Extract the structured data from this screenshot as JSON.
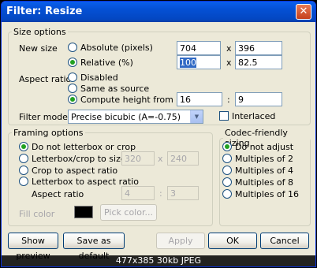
{
  "window": {
    "title": "Filter: Resize"
  },
  "size_options": {
    "legend": "Size options",
    "new_size_label": "New size",
    "absolute_label": "Absolute (pixels)",
    "absolute_w": "704",
    "absolute_h": "396",
    "relative_label": "Relative (%)",
    "relative_w": "100",
    "relative_h": "82.5",
    "times": "x",
    "aspect_ratio_label": "Aspect ratio",
    "disabled_label": "Disabled",
    "same_label": "Same as source",
    "compute_label": "Compute height from ratio:",
    "ratio_a": "16",
    "ratio_b": "9",
    "colon": ":",
    "filter_mode_label": "Filter mode",
    "filter_mode_value": "Precise bicubic (A=-0.75)",
    "interlaced_label": "Interlaced"
  },
  "framing": {
    "legend": "Framing options",
    "no_letterbox": "Do not letterbox or crop",
    "letterbox_size": "Letterbox/crop to size:",
    "size_w": "320",
    "size_h": "240",
    "times": "x",
    "crop_aspect": "Crop to aspect ratio",
    "letterbox_aspect": "Letterbox to aspect ratio",
    "aspect_ratio_label": "Aspect ratio",
    "ar_a": "4",
    "ar_b": "3",
    "colon": ":",
    "fill_color_label": "Fill color",
    "fill_color": "#000000",
    "pick_color": "Pick color..."
  },
  "codec": {
    "legend": "Codec-friendly sizing",
    "options": [
      "Do not adjust",
      "Multiples of 2",
      "Multiples of 4",
      "Multiples of 8",
      "Multiples of 16"
    ]
  },
  "buttons": {
    "show_preview": "Show preview",
    "save_default": "Save as default",
    "apply": "Apply",
    "ok": "OK",
    "cancel": "Cancel"
  },
  "caption": "477x385 30kb JPEG"
}
